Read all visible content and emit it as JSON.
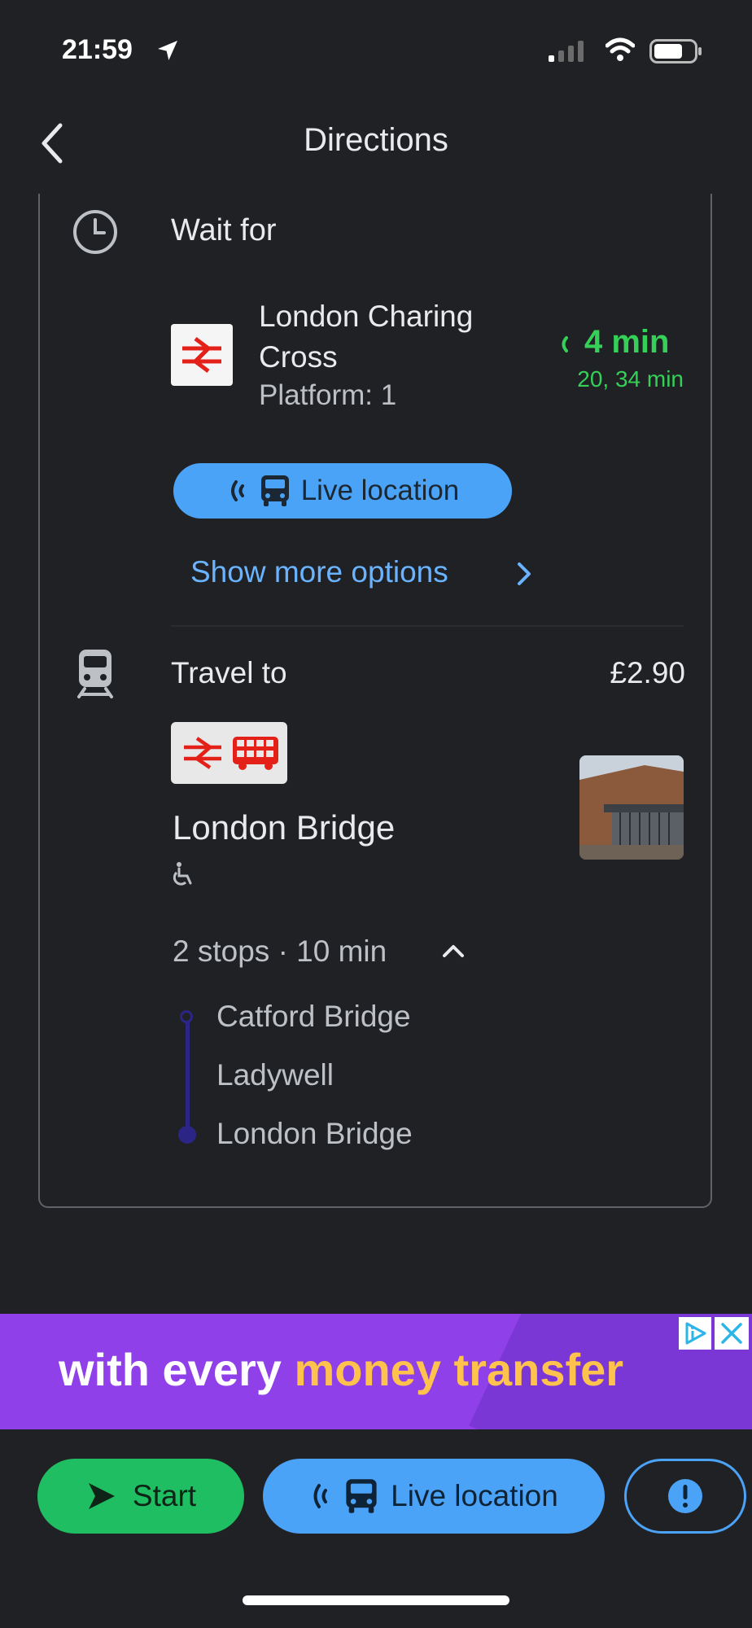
{
  "status_bar": {
    "time": "21:59"
  },
  "header": {
    "title": "Directions"
  },
  "wait_step": {
    "label": "Wait for",
    "station": "London Charing Cross",
    "platform": "Platform: 1",
    "next_departure": "4 min",
    "later_departures": "20, 34 min",
    "live_location_label": "Live location",
    "show_more_label": "Show more options"
  },
  "travel_step": {
    "label": "Travel to",
    "fare": "£2.90",
    "destination": "London Bridge",
    "stops_summary": "2 stops · 10 min",
    "stops": [
      "Catford Bridge",
      "Ladywell",
      "London Bridge"
    ]
  },
  "ad": {
    "text_start": "with every ",
    "text_highlight": "money transfer"
  },
  "bottom_bar": {
    "start_label": "Start",
    "live_location_label": "Live location"
  },
  "colors": {
    "background": "#202124",
    "accent_blue": "#4ba3f7",
    "live_green": "#34d058",
    "start_green": "#1fbe62",
    "route_line": "#2b2585",
    "national_rail_red": "#e32119"
  },
  "icons": [
    "location-arrow-icon",
    "signal-icon",
    "wifi-icon",
    "battery-icon",
    "back-chevron-icon",
    "clock-icon",
    "national-rail-icon",
    "live-signal-icon",
    "bus-icon",
    "chevron-right-icon",
    "train-icon",
    "double-decker-bus-icon",
    "wheelchair-icon",
    "chevron-up-icon",
    "ad-choices-icon",
    "close-icon",
    "play-arrow-icon",
    "exclamation-icon"
  ]
}
